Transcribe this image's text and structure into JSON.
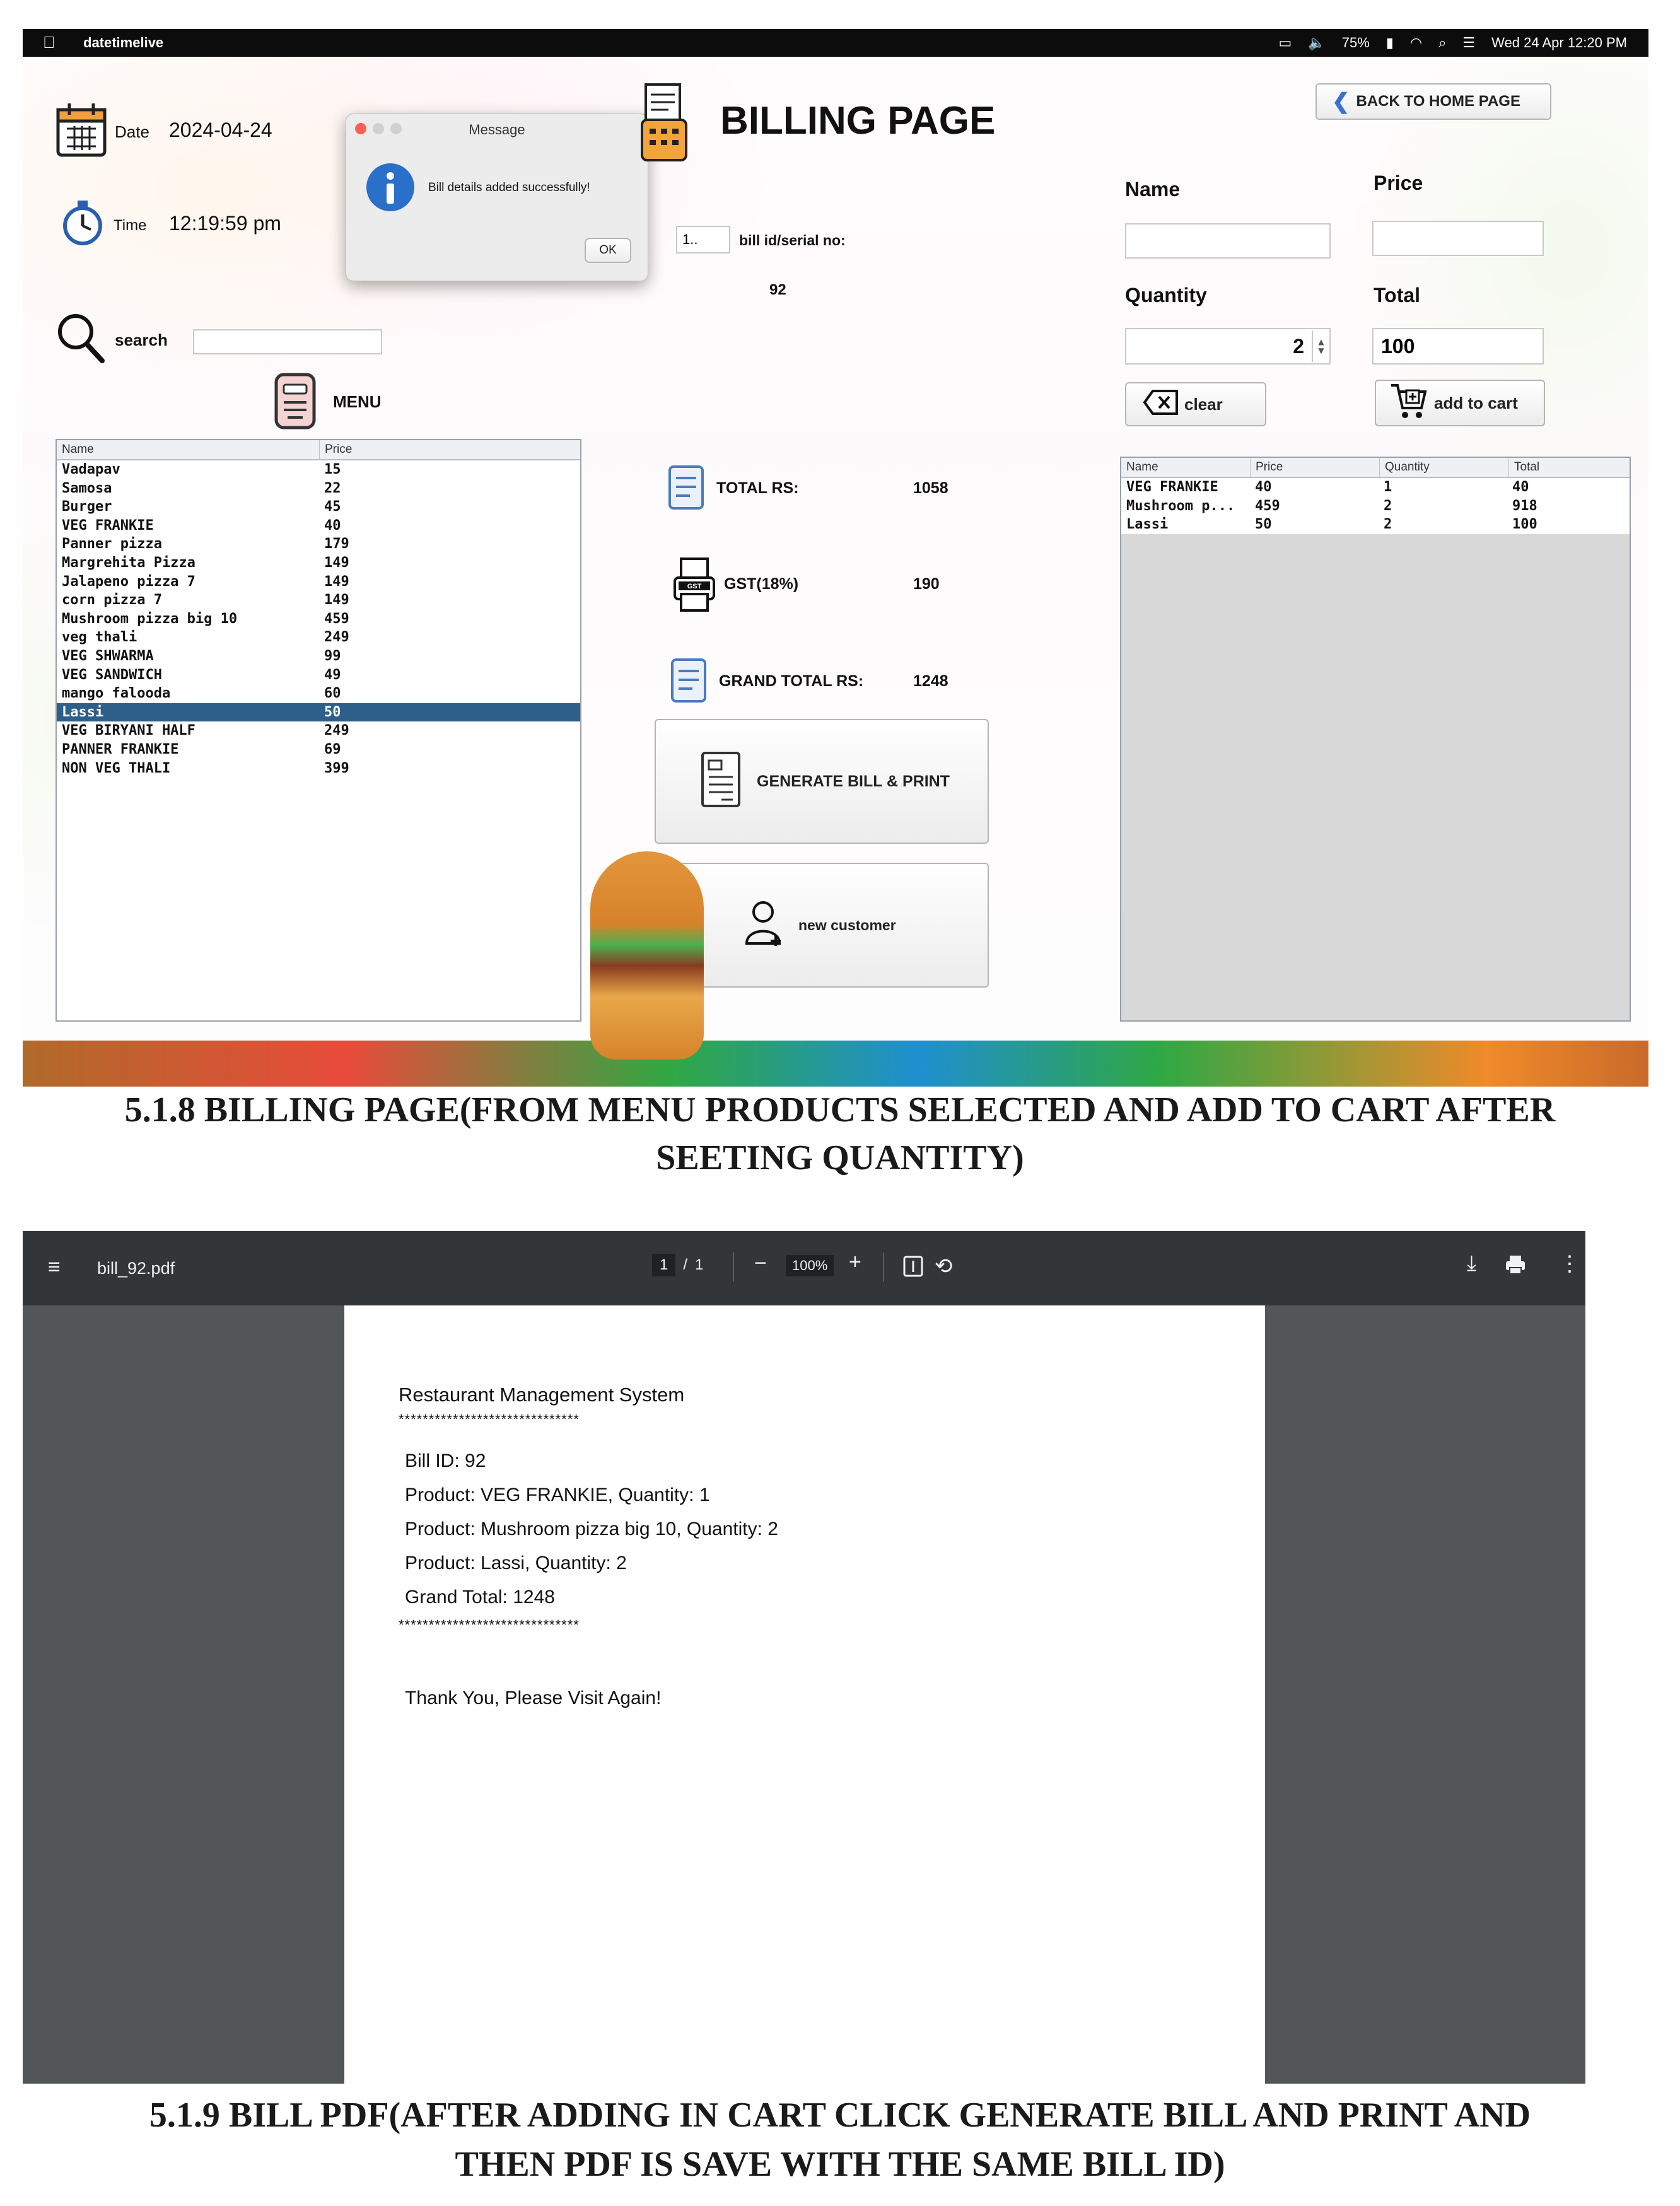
{
  "macos_menubar": {
    "app_name": "datetimelive",
    "battery": "75%",
    "datetime": "Wed 24 Apr  12:20 PM"
  },
  "billing": {
    "page_title": "BILLING PAGE",
    "back_button": "BACK TO HOME PAGE",
    "date_label": "Date",
    "date_value": "2024-04-24",
    "time_label": "Time",
    "time_value": "12:19:59 pm",
    "search_label": "search",
    "search_value": "",
    "menu_label": "MENU",
    "bill_id_prefix": "1..",
    "bill_id_label": "bill id/serial no:",
    "bill_id_value": "92",
    "name_label": "Name",
    "name_value": "",
    "price_label": "Price",
    "price_value": "",
    "quantity_label": "Quantity",
    "quantity_value": "2",
    "total_label": "Total",
    "total_value": "100",
    "clear_button": "clear",
    "add_to_cart_button": "add to cart",
    "total_rs_label": "TOTAL RS:",
    "total_rs_value": "1058",
    "gst_label": "GST(18%)",
    "gst_value": "190",
    "grand_total_label": "GRAND TOTAL RS:",
    "grand_total_value": "1248",
    "generate_bill_button": "GENERATE BILL & PRINT",
    "new_customer_button": "new customer",
    "gst_icon_text": "GST",
    "menu_table": {
      "columns": [
        "Name",
        "Price"
      ],
      "selected_index": 13,
      "rows": [
        [
          "Vadapav",
          "15"
        ],
        [
          "Samosa",
          "22"
        ],
        [
          "Burger",
          "45"
        ],
        [
          "VEG FRANKIE",
          "40"
        ],
        [
          "Panner pizza",
          "179"
        ],
        [
          "Margrehita Pizza",
          "149"
        ],
        [
          "Jalapeno pizza 7",
          "149"
        ],
        [
          "corn pizza 7",
          "149"
        ],
        [
          "Mushroom pizza big 10",
          "459"
        ],
        [
          "veg thali",
          "249"
        ],
        [
          "VEG SHWARMA",
          "99"
        ],
        [
          "VEG SANDWICH",
          "49"
        ],
        [
          "mango falooda",
          "60"
        ],
        [
          "Lassi",
          "50"
        ],
        [
          "VEG BIRYANI HALF",
          "249"
        ],
        [
          "PANNER FRANKIE",
          "69"
        ],
        [
          "NON VEG THALI",
          "399"
        ]
      ]
    },
    "cart_table": {
      "columns": [
        "Name",
        "Price",
        "Quantity",
        "Total"
      ],
      "rows": [
        [
          "VEG FRANKIE",
          "40",
          "1",
          "40"
        ],
        [
          "Mushroom p...",
          "459",
          "2",
          "918"
        ],
        [
          "Lassi",
          "50",
          "2",
          "100"
        ]
      ]
    },
    "dialog": {
      "title": "Message",
      "message": "Bill details added successfully!",
      "ok_button": "OK"
    }
  },
  "caption_1": {
    "line1": "5.1.8 BILLING PAGE(FROM MENU PRODUCTS SELECTED AND ADD TO CART AFTER",
    "line2": "SEETING QUANTITY)"
  },
  "pdf_viewer": {
    "file_name": "bill_92.pdf",
    "page_current": "1",
    "page_sep": "/",
    "page_total": "1",
    "zoom": "100%",
    "page_lines": {
      "heading": "Restaurant Management System",
      "separator": "******************************",
      "bill_id": "Bill ID: 92",
      "product_1": "Product: VEG FRANKIE, Quantity: 1",
      "product_2": "Product: Mushroom pizza big 10, Quantity: 2",
      "product_3": "Product: Lassi, Quantity: 2",
      "grand_total": "Grand Total: 1248",
      "thanks": "Thank You, Please Visit Again!"
    }
  },
  "caption_2": {
    "line1": "5.1.9 BILL PDF(AFTER ADDING IN CART CLICK GENERATE BILL AND PRINT AND",
    "line2": "THEN PDF IS SAVE WITH THE SAME BILL ID)"
  },
  "colors": {
    "selected_row": "#2e5f8a",
    "pdf_toolbar": "#323639",
    "pdf_background": "#525659",
    "dialog_info_icon": "#2a6fc9"
  },
  "icons": {
    "apple": "apple-logo-icon",
    "calendar": "calendar-icon",
    "stopwatch": "stopwatch-icon",
    "search": "search-icon",
    "menu": "menu-card-icon",
    "billing": "receipt-icon",
    "back": "chevron-left-icon",
    "clear": "backspace-icon",
    "cart": "cart-plus-icon",
    "receipt": "receipt-icon",
    "gst": "gst-printer-icon",
    "person": "user-add-icon",
    "info": "info-icon"
  }
}
